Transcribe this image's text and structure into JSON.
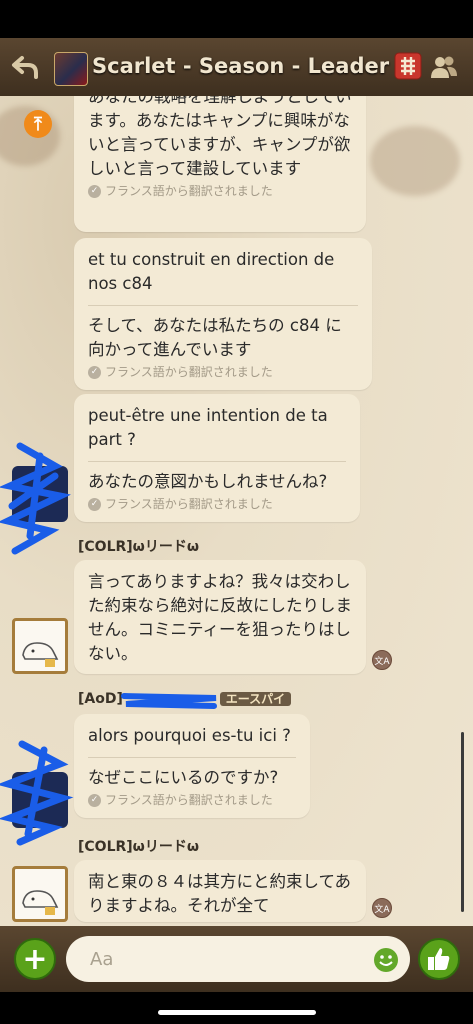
{
  "header": {
    "title": "Scarlet - Season - Leader (4"
  },
  "messages": [
    {
      "original": "",
      "translation": "あなたの戦略を理解しようとしています。あなたはキャンプに興味がないと言っていますが、キャンプが欲しいと言って建設しています",
      "translation_visible": "います。あなたはキャンプに興味がないと言っていますが、キャンプが欲しいと言って建設しています",
      "note": "フランス語から翻訳されました"
    },
    {
      "original": "et tu construit en direction de nos c84",
      "translation": "そして、あなたは私たちの c84 に向かって進んでいます",
      "note": "フランス語から翻訳されました"
    },
    {
      "original": "peut-être une intention de ta part ?",
      "translation": "あなたの意図かもしれませんね?",
      "note": "フランス語から翻訳されました"
    },
    {
      "sender": "[COLR]ωリードω",
      "text": "言ってありますよね？我々は交わした約束なら絶対に反故にしたりしません。コミニティーを狙ったりはしない。",
      "reaction": "文A"
    },
    {
      "sender": "[AoD]",
      "sender_badge": "エースパイ",
      "original": "alors pourquoi es-tu ici ?",
      "translation": "なぜここにいるのですか?",
      "note": "フランス語から翻訳されました"
    },
    {
      "sender": "[COLR]ωリードω",
      "text": "南と東の８４は其方にと約束してありますよね。それが全て",
      "reaction": "文A"
    }
  ],
  "composer": {
    "placeholder": "Aa"
  },
  "icons": {
    "back": "back-arrow-icon",
    "translate": "translate-icon",
    "members": "members-icon",
    "scroll_top": "scroll-to-top-icon",
    "add": "plus-icon",
    "emoji": "emoji-icon",
    "like": "thumbs-up-icon"
  },
  "colors": {
    "header_bg": "#4a3826",
    "bubble_bg": "#f3ead5",
    "accent_green": "#5aa21a",
    "accent_orange": "#f08a1a"
  }
}
